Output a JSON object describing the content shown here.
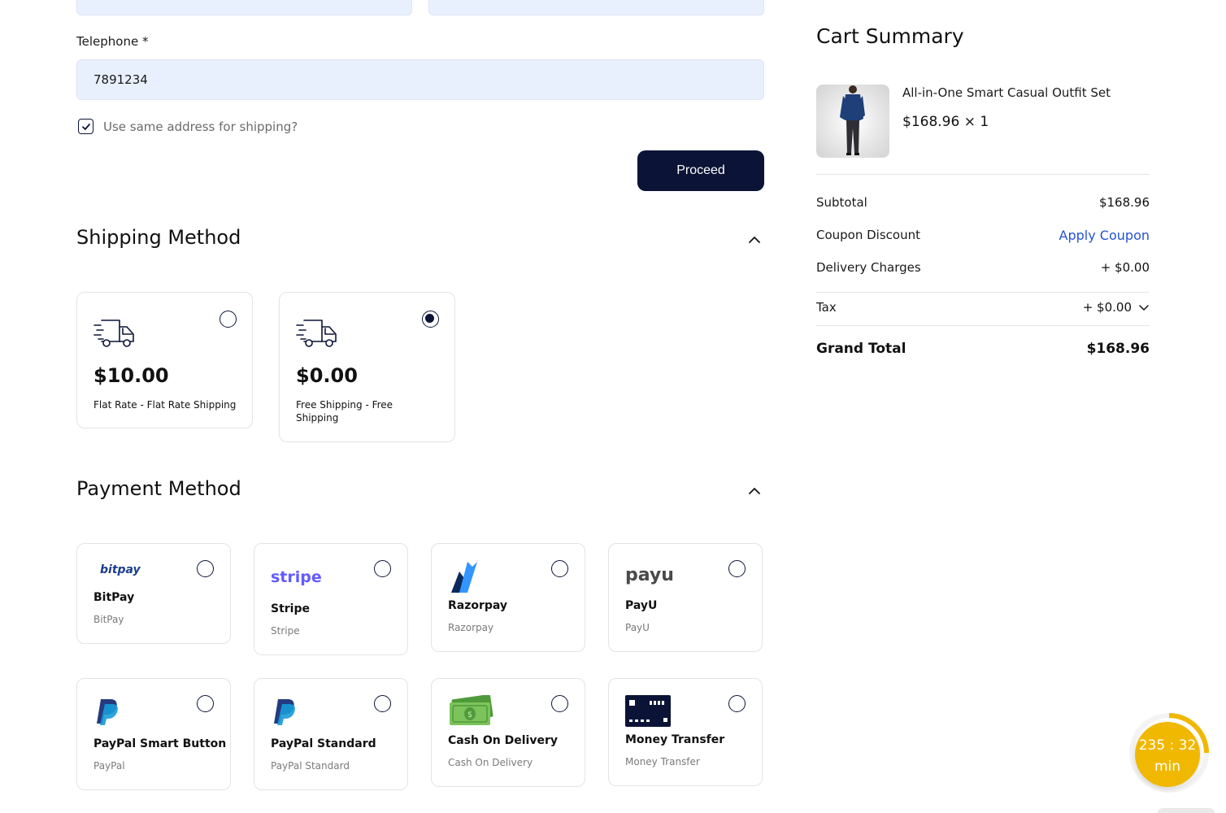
{
  "form": {
    "telephone_label": "Telephone *",
    "telephone_value": "7891234",
    "same_address_label": "Use same address for shipping?",
    "proceed_label": "Proceed"
  },
  "shipping": {
    "title": "Shipping Method",
    "options": [
      {
        "price": "$10.00",
        "label": "Flat Rate - Flat Rate Shipping",
        "selected": false,
        "icon": "truck-icon"
      },
      {
        "price": "$0.00",
        "label": "Free Shipping - Free Shipping",
        "selected": true,
        "icon": "truck-icon"
      }
    ]
  },
  "payment": {
    "title": "Payment Method",
    "options": [
      {
        "logo_text": "bitpay",
        "name": "BitPay",
        "sub": "BitPay",
        "logo_color": "#1a3e8c"
      },
      {
        "logo_text": "stripe",
        "name": "Stripe",
        "sub": "Stripe",
        "logo_color": "#635bff"
      },
      {
        "name": "Razorpay",
        "sub": "Razorpay",
        "logo_color": "#3395ff"
      },
      {
        "logo_text": "payu",
        "name": "PayU",
        "sub": "PayU",
        "logo_color": "#4a4a4a"
      },
      {
        "name": "PayPal Smart Button",
        "sub": "PayPal",
        "logo_color": "#253b80"
      },
      {
        "name": "PayPal Standard",
        "sub": "PayPal Standard",
        "logo_color": "#253b80"
      },
      {
        "name": "Cash On Delivery",
        "sub": "Cash On Delivery",
        "logo_color": "#6dbb4a"
      },
      {
        "name": "Money Transfer",
        "sub": "Money Transfer",
        "logo_color": "#0b1437"
      }
    ]
  },
  "cart": {
    "title": "Cart Summary",
    "product_name": "All-in-One Smart Casual Outfit Set",
    "product_price": "$168.96 × 1",
    "subtotal_label": "Subtotal",
    "subtotal_value": "$168.96",
    "coupon_label": "Coupon Discount",
    "coupon_action": "Apply Coupon",
    "delivery_label": "Delivery Charges",
    "delivery_value": "+ $0.00",
    "tax_label": "Tax",
    "tax_value": "+ $0.00",
    "grand_label": "Grand Total",
    "grand_value": "$168.96"
  },
  "timer": {
    "value": "235 : 32",
    "unit": "min",
    "color": "#f0b800"
  },
  "colors": {
    "primary": "#0b1437",
    "input_bg": "#e8effd",
    "link": "#2453d6"
  }
}
